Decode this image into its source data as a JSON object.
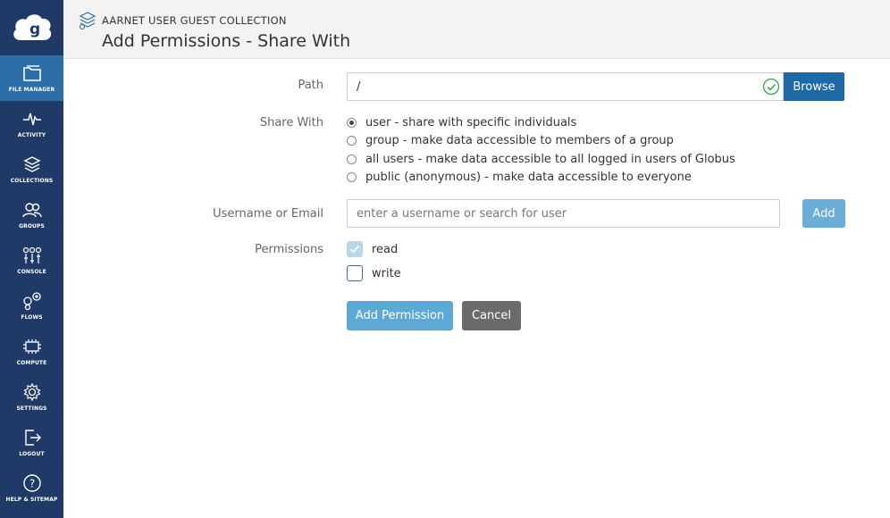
{
  "sidebar": {
    "items": [
      {
        "label": "FILE MANAGER",
        "icon": "folder-icon",
        "active": true
      },
      {
        "label": "ACTIVITY",
        "icon": "pulse-icon"
      },
      {
        "label": "COLLECTIONS",
        "icon": "layers-icon"
      },
      {
        "label": "GROUPS",
        "icon": "people-icon"
      },
      {
        "label": "CONSOLE",
        "icon": "sliders-icon"
      },
      {
        "label": "FLOWS",
        "icon": "flows-icon"
      },
      {
        "label": "COMPUTE",
        "icon": "chip-icon"
      },
      {
        "label": "SETTINGS",
        "icon": "gear-icon"
      },
      {
        "label": "LOGOUT",
        "icon": "logout-icon"
      },
      {
        "label": "HELP & SITEMAP",
        "icon": "help-icon"
      }
    ]
  },
  "header": {
    "collection_name": "AARNET USER GUEST COLLECTION",
    "title": "Add Permissions - Share With"
  },
  "form": {
    "path_label": "Path",
    "path_value": "/",
    "browse_label": "Browse",
    "share_with_label": "Share With",
    "share_options": [
      {
        "label": "user - share with specific individuals",
        "checked": true
      },
      {
        "label": "group - make data accessible to members of a group",
        "checked": false
      },
      {
        "label": "all users - make data accessible to all logged in users of Globus",
        "checked": false
      },
      {
        "label": "public (anonymous) - make data accessible to everyone",
        "checked": false
      }
    ],
    "username_label": "Username or Email",
    "username_placeholder": "enter a username or search for user",
    "add_label": "Add",
    "permissions_label": "Permissions",
    "permissions": [
      {
        "label": "read",
        "checked": true,
        "disabled": true
      },
      {
        "label": "write",
        "checked": false,
        "disabled": false
      }
    ],
    "add_permission_label": "Add Permission",
    "cancel_label": "Cancel"
  },
  "colors": {
    "sidebar_bg": "#1f3a67",
    "sidebar_active": "#2b6ea8",
    "primary_button": "#1d6aa7",
    "light_button": "#5ea8d6",
    "cancel_button": "#6b6b6b",
    "success_check": "#3aa64c"
  }
}
